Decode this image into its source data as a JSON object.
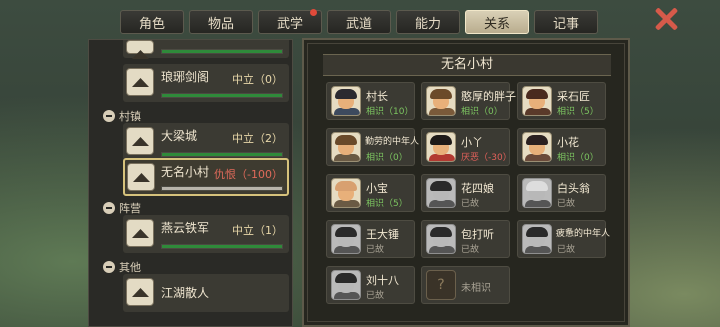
{
  "tabs": [
    {
      "label": "角色",
      "active": false,
      "badge": false
    },
    {
      "label": "物品",
      "active": false,
      "badge": false
    },
    {
      "label": "武学",
      "active": false,
      "badge": true
    },
    {
      "label": "武道",
      "active": false,
      "badge": false
    },
    {
      "label": "能力",
      "active": false,
      "badge": false
    },
    {
      "label": "关系",
      "active": true,
      "badge": false
    },
    {
      "label": "记事",
      "active": false,
      "badge": false
    }
  ],
  "factions": {
    "partial": {
      "bar": 1.0,
      "bar_color": "#2f8a3a"
    },
    "langya": {
      "name": "琅琊剑阁",
      "status": "中立（0）",
      "bar": 1.0,
      "bar_color": "#2f8a3a"
    },
    "cat_towns": "村镇",
    "daliang": {
      "name": "大梁城",
      "status": "中立（2）",
      "bar": 1.0,
      "bar_color": "#2f8a3a"
    },
    "wuming": {
      "name": "无名小村",
      "status": "仇恨（-100）",
      "bar": 1.0,
      "bar_color": "#b8b4aa"
    },
    "cat_camps": "阵营",
    "yanyun": {
      "name": "燕云铁军",
      "status": "中立（1）",
      "bar": 1.0,
      "bar_color": "#2f8a3a"
    },
    "cat_other": "其他",
    "jianghu": {
      "name": "江湖散人"
    }
  },
  "village": {
    "title": "无名小村",
    "people": [
      {
        "name": "村长",
        "rel": "相识（10）",
        "kind": "g",
        "hair": "#2b2a30",
        "body": "#3d4a5e"
      },
      {
        "name": "憨厚的胖子",
        "rel": "相识（0）",
        "kind": "g",
        "hair": "#6b4a2a",
        "body": "#7a5a3a"
      },
      {
        "name": "采石匠",
        "rel": "相识（5）",
        "kind": "g",
        "hair": "#4a2a1e",
        "body": "#5a3a2a"
      },
      {
        "name": "勤劳的中年人",
        "rel": "相识（0）",
        "kind": "g",
        "hair": "#6a4a2a",
        "body": "#6a5a44",
        "small": true
      },
      {
        "name": "小丫",
        "rel": "厌恶（-30）",
        "kind": "r",
        "hair": "#1e1a18",
        "body": "#b23a32"
      },
      {
        "name": "小花",
        "rel": "相识（0）",
        "kind": "g",
        "hair": "#2a2020",
        "body": "#6a4a3a"
      },
      {
        "name": "小宝",
        "rel": "相识（5）",
        "kind": "g",
        "hair": "#d8a070",
        "body": "#6a5a44"
      },
      {
        "name": "花四娘",
        "rel": "已故",
        "kind": "d",
        "hair": "#2a2a2a",
        "body": "#555555",
        "dead": true
      },
      {
        "name": "白头翁",
        "rel": "已故",
        "kind": "d",
        "hair": "#dddddd",
        "body": "#555555",
        "dead": true
      },
      {
        "name": "王大锤",
        "rel": "已故",
        "kind": "d",
        "hair": "#2a2a2a",
        "body": "#555555",
        "dead": true
      },
      {
        "name": "包打听",
        "rel": "已故",
        "kind": "d",
        "hair": "#2a2a2a",
        "body": "#555555",
        "dead": true
      },
      {
        "name": "疲惫的中年人",
        "rel": "已故",
        "kind": "d",
        "hair": "#2a2a2a",
        "body": "#555555",
        "dead": true,
        "small": true
      },
      {
        "name": "刘十八",
        "rel": "已故",
        "kind": "d",
        "hair": "#2a2a2a",
        "body": "#555555",
        "dead": true
      },
      {
        "name": "",
        "rel": "未相识",
        "kind": "d",
        "unknown": true
      }
    ]
  }
}
